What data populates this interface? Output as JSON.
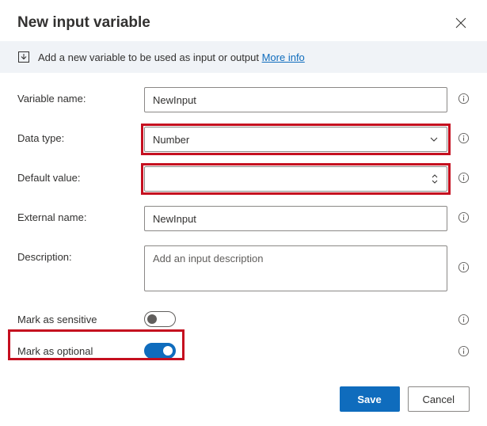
{
  "header": {
    "title": "New input variable"
  },
  "banner": {
    "text": "Add a new variable to be used as input or output",
    "link_label": "More info"
  },
  "fields": {
    "variable_name": {
      "label": "Variable name:",
      "value": "NewInput"
    },
    "data_type": {
      "label": "Data type:",
      "value": "Number"
    },
    "default_value": {
      "label": "Default value:",
      "value": ""
    },
    "external_name": {
      "label": "External name:",
      "value": "NewInput"
    },
    "description": {
      "label": "Description:",
      "placeholder": "Add an input description"
    },
    "mark_sensitive": {
      "label": "Mark as sensitive"
    },
    "mark_optional": {
      "label": "Mark as optional"
    }
  },
  "footer": {
    "save_label": "Save",
    "cancel_label": "Cancel"
  }
}
